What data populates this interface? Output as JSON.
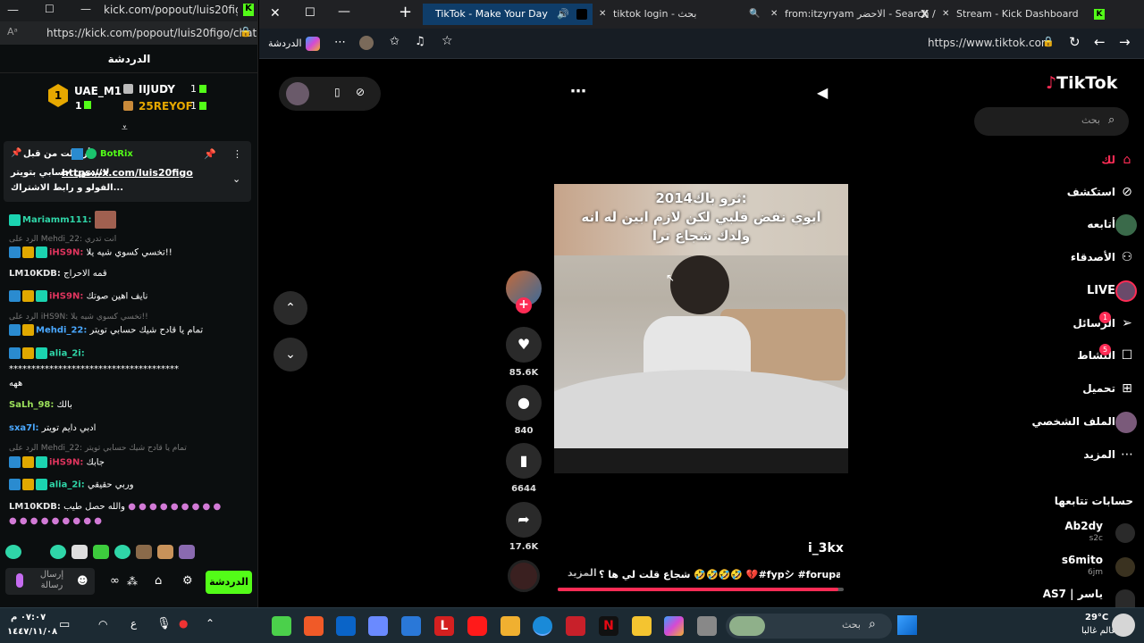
{
  "kick_window": {
    "title": "kick.com/popout/luis20figo...",
    "url": "https://kick.com/popout/luis20figo/chat",
    "header": "الدردشة",
    "leaderboard": {
      "first": {
        "rank": "1",
        "name": "UAE_M1",
        "count": "1"
      },
      "second": {
        "name": "IIJUDY",
        "count": "1"
      },
      "third": {
        "name": "25REYOF",
        "count": "1"
      }
    },
    "pinned": {
      "prefix": "أرسلت من قبل",
      "sender": "BotRix",
      "line1_link": "https://x.com/luis20figo",
      "line1_text": "لاتنسون حسابي بتويتر",
      "line2": "الفولو و رابط الاشتراك..."
    },
    "messages": [
      {
        "user": "Mariamm111:",
        "text": ""
      },
      {
        "reply": "الرد على Mehdi_22: انت تدري"
      },
      {
        "user": "iHS9N:",
        "text": "تخسي كسوي شيه يلا!!"
      },
      {
        "user": "LM10KDB:",
        "text": "قمه الاحراج"
      },
      {
        "user": "iHS9N:",
        "text": "نايف اهين صوتك"
      },
      {
        "reply": "الرد على iHS9N: تخسي كسوي شيه يلا!!"
      },
      {
        "user": "Mehdi_22:",
        "text": "تمام يا قادح شيك حسابي تويتر"
      },
      {
        "user": "alia_2i:",
        "text": ""
      },
      {
        "user": "",
        "text": "**************************************"
      },
      {
        "user": "",
        "text": "ههه"
      },
      {
        "user": "SaLh_98:",
        "text": "بالك"
      },
      {
        "user": "sxa7l:",
        "text": "ادبي دايم تويتر"
      },
      {
        "reply": "الرد على Mehdi_22: تمام يا قادح شيك حسابي تويتر"
      },
      {
        "user": "iHS9N:",
        "text": "جابك"
      },
      {
        "user": "alia_2i:",
        "text": "وربي حقيقي"
      },
      {
        "user": "LM10KDB:",
        "text": "والله حصل طيب"
      }
    ],
    "input_placeholder": "إرسال رسالة",
    "chat_button": "الدردشة"
  },
  "browser": {
    "tabs": [
      {
        "label": "TikTok - Make Your Day",
        "active": true
      },
      {
        "label": "tiktok login - بحث"
      },
      {
        "label": "from:itzyryam الاحضر - Search / X"
      },
      {
        "label": "Stream - Kick Dashboard"
      }
    ],
    "copilot_label": "الدردشة",
    "url": "https://www.tiktok.com"
  },
  "tiktok": {
    "logo": "TikTok",
    "search_placeholder": "بحث",
    "nav": [
      {
        "label": "لك",
        "icon": "home-icon",
        "active": true
      },
      {
        "label": "استكشف",
        "icon": "compass-icon"
      },
      {
        "label": "أتابعه",
        "icon": "following-icon"
      },
      {
        "label": "الأصدقاء",
        "icon": "friends-icon"
      },
      {
        "label": "LIVE",
        "icon": "live-icon"
      },
      {
        "label": "الرسائل",
        "icon": "messages-icon",
        "badge": "1"
      },
      {
        "label": "النشاط",
        "icon": "activity-icon",
        "badge": "5"
      },
      {
        "label": "تحميل",
        "icon": "upload-icon"
      },
      {
        "label": "الملف الشخصي",
        "icon": "profile-icon"
      },
      {
        "label": "المزيد",
        "icon": "more-icon"
      }
    ],
    "following_header": "حسابات تتابعها",
    "following": [
      {
        "name": "Ab2dy",
        "sub": "s2c"
      },
      {
        "name": "s6mito",
        "sub": "6jm"
      },
      {
        "name": "AS7 | ياسر",
        "sub": ""
      }
    ],
    "video": {
      "caption_line1": "ثرو باك2014:",
      "caption_line2": "ابوي نفض قلبي لكن لازم ابين له انه",
      "caption_line3": "ولدك شجاع ترا",
      "author": "i_3kx",
      "description": "شجاع قلت لي ها ؟ 🤣🤣🤣🤣 💔#fypシ #forupage ...",
      "more": "المزيد",
      "progress": 0.98
    },
    "actions": {
      "likes": "85.6K",
      "comments": "840",
      "saves": "6644",
      "shares": "17.6K"
    }
  },
  "taskbar": {
    "search": "بحث",
    "weather_temp": "29°C",
    "weather_desc": "عالم غالبا",
    "time": "٠٧:٠٧ م",
    "date": "١٤٤٧/١١/٠٨",
    "lang": "ع"
  }
}
